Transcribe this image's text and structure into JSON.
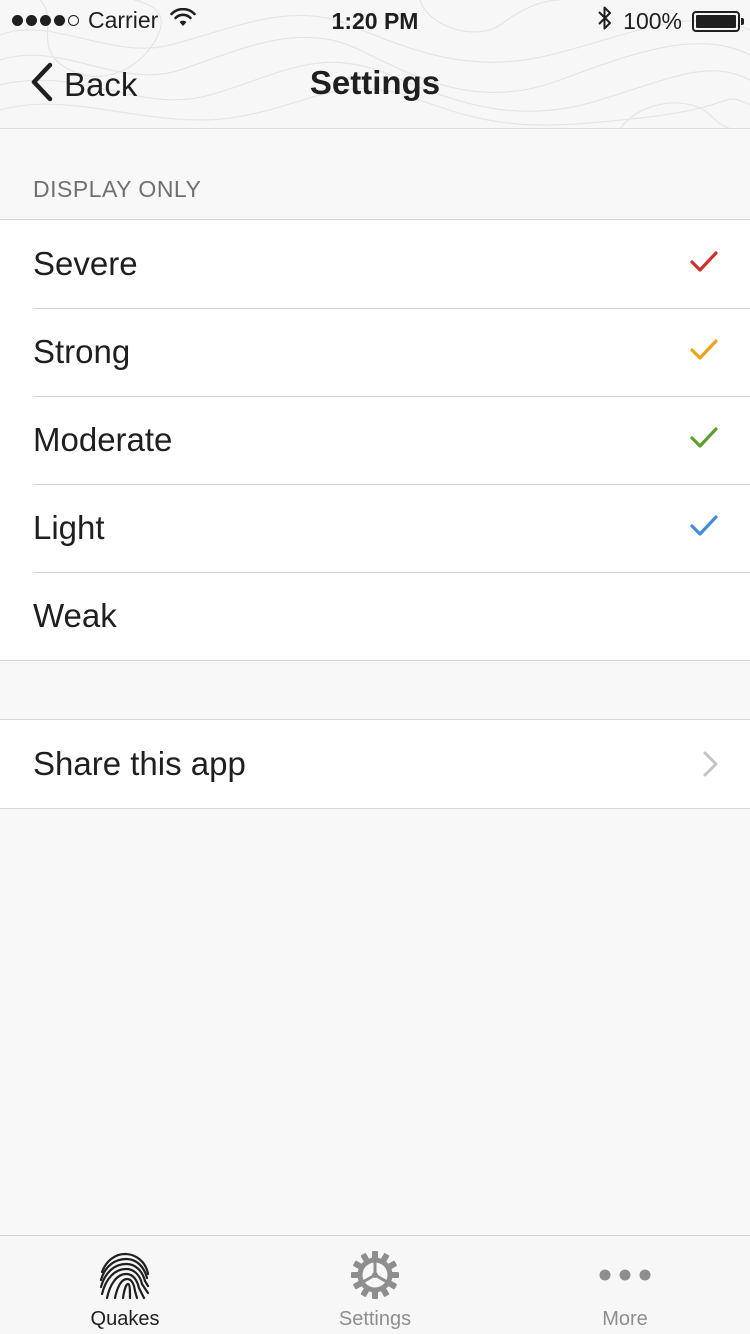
{
  "status_bar": {
    "carrier": "Carrier",
    "time": "1:20 PM",
    "battery": "100%",
    "signal_icon": "signal-dots-icon",
    "wifi_icon": "wifi-icon",
    "bluetooth_icon": "bluetooth-icon",
    "battery_icon": "battery-icon"
  },
  "nav": {
    "back_label": "Back",
    "title": "Settings"
  },
  "filters": {
    "header": "DISPLAY ONLY",
    "items": [
      {
        "label": "Severe",
        "checked": true,
        "color": "#d0312d"
      },
      {
        "label": "Strong",
        "checked": true,
        "color": "#f0a11c"
      },
      {
        "label": "Moderate",
        "checked": true,
        "color": "#5aa02c"
      },
      {
        "label": "Light",
        "checked": true,
        "color": "#3e8de0"
      },
      {
        "label": "Weak",
        "checked": false,
        "color": "#999999"
      }
    ]
  },
  "share": {
    "label": "Share this app"
  },
  "tabbar": {
    "tabs": [
      {
        "label": "Quakes",
        "icon": "fingerprint-icon",
        "active": true
      },
      {
        "label": "Settings",
        "icon": "gear-icon",
        "active": false
      },
      {
        "label": "More",
        "icon": "more-dots-icon",
        "active": false
      }
    ]
  }
}
